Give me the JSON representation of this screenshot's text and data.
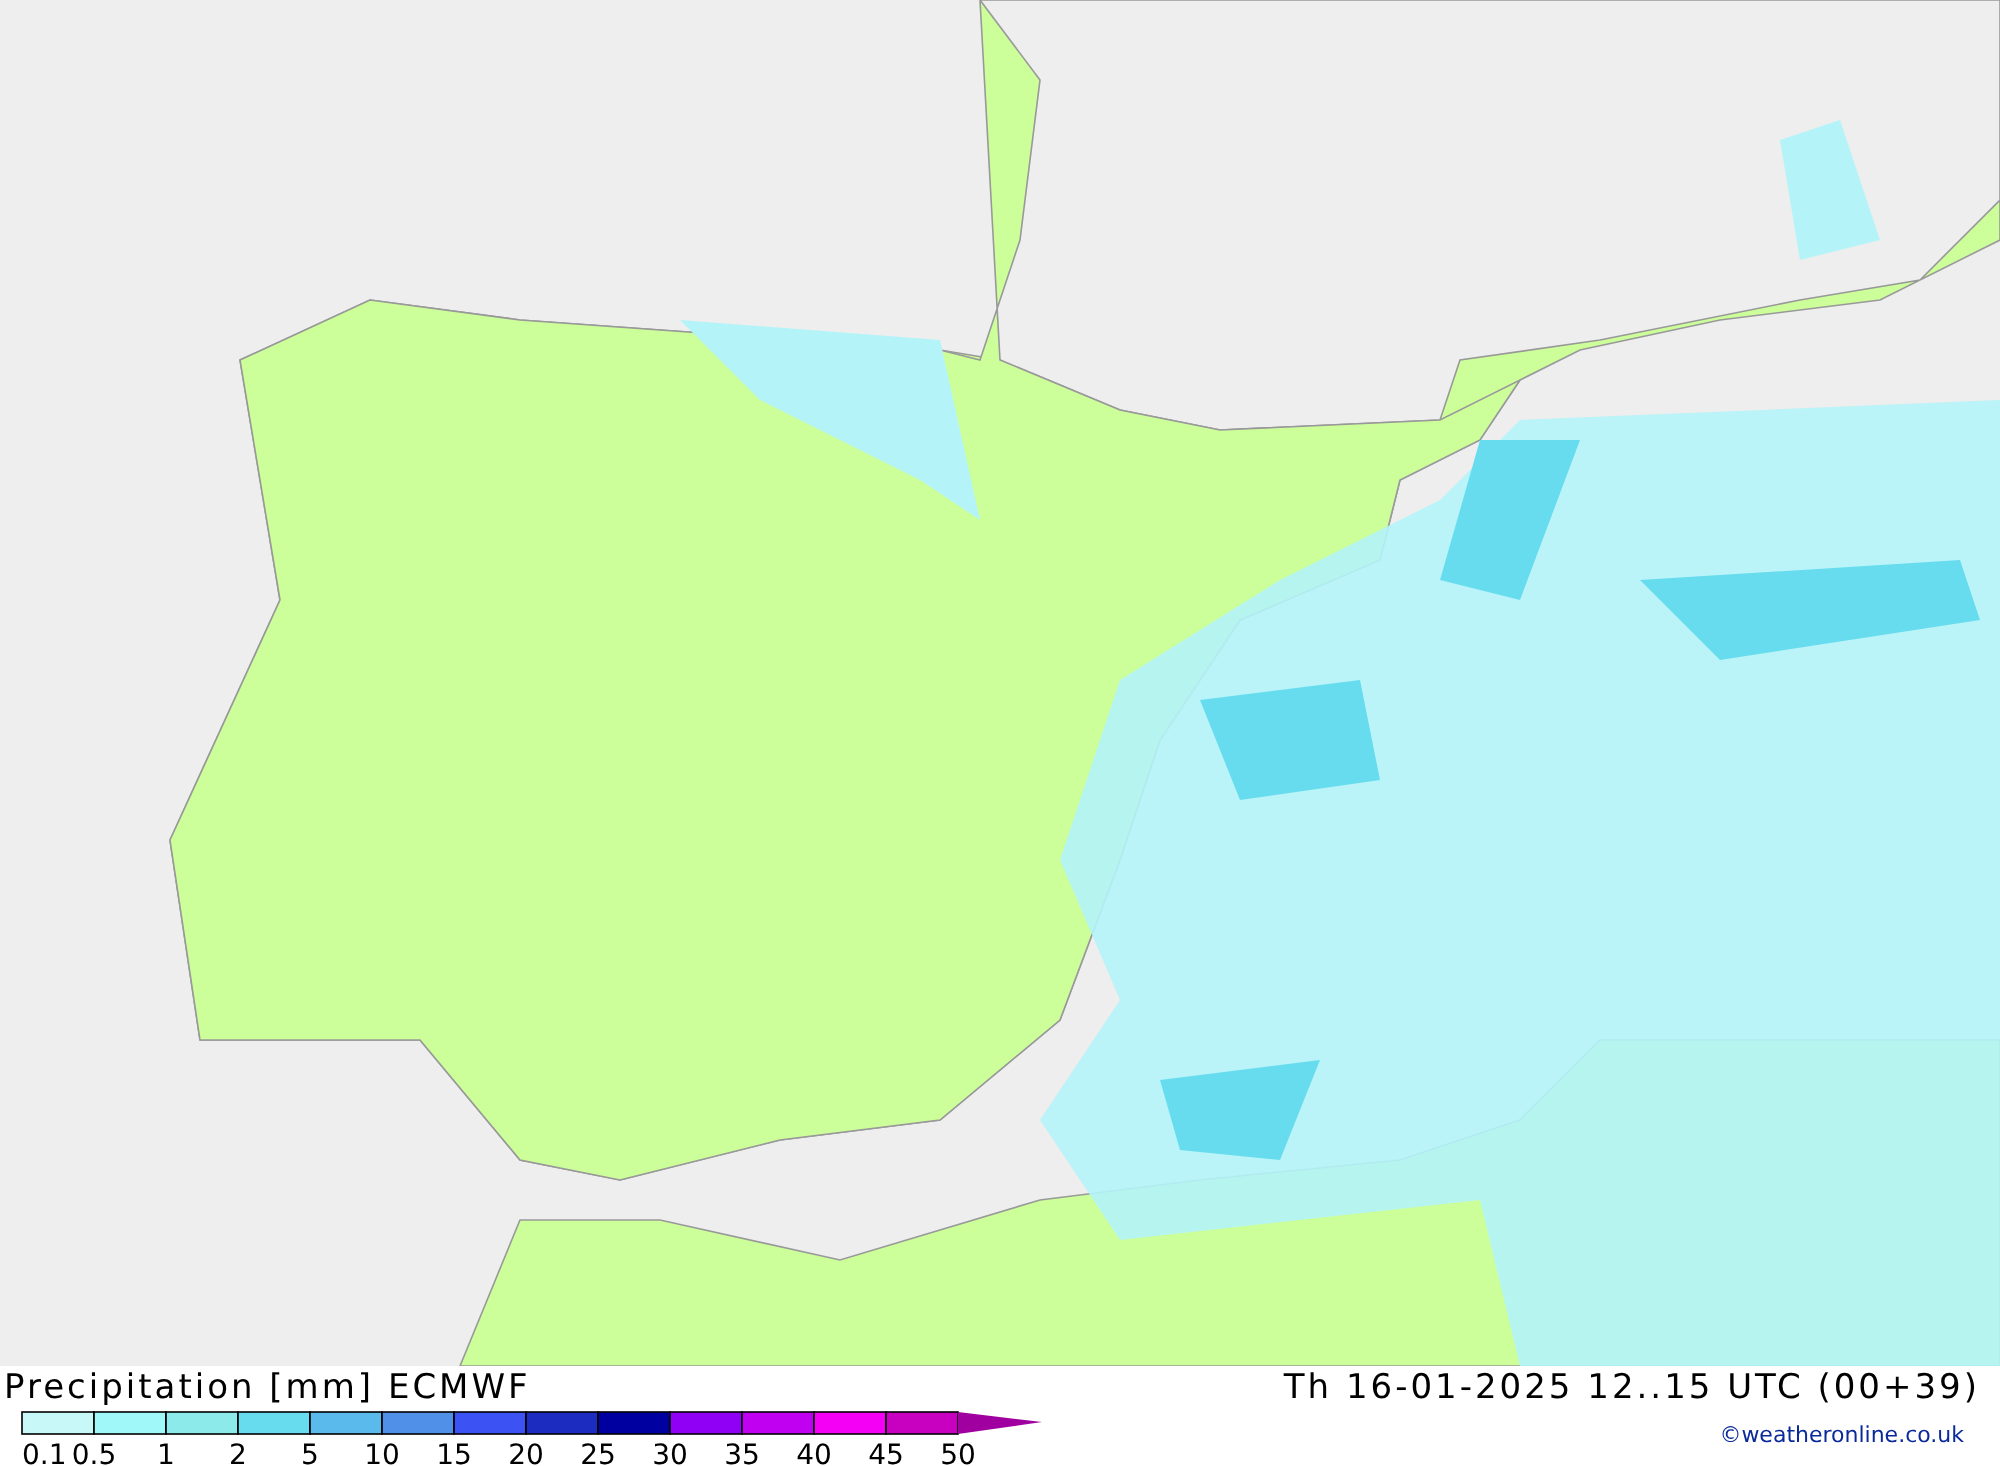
{
  "title": "Precipitation [mm] ECMWF",
  "valid_time": "Th 16-01-2025 12..15 UTC (00+39)",
  "credit": "©weatheronline.co.uk",
  "legend": {
    "swatches": [
      {
        "color": "#c8f8f8"
      },
      {
        "color": "#a0f8f8"
      },
      {
        "color": "#8ceaea"
      },
      {
        "color": "#66dcee"
      },
      {
        "color": "#5abaec"
      },
      {
        "color": "#5090e8"
      },
      {
        "color": "#3c52f2"
      },
      {
        "color": "#1c2cc0"
      },
      {
        "color": "#0000a0"
      },
      {
        "color": "#9000f4"
      },
      {
        "color": "#c000f0"
      },
      {
        "color": "#f400f4"
      },
      {
        "color": "#c800c0"
      }
    ],
    "labels": [
      "0.1",
      "0.5",
      "1",
      "2",
      "5",
      "10",
      "15",
      "20",
      "25",
      "30",
      "35",
      "40",
      "45",
      "50"
    ]
  }
}
